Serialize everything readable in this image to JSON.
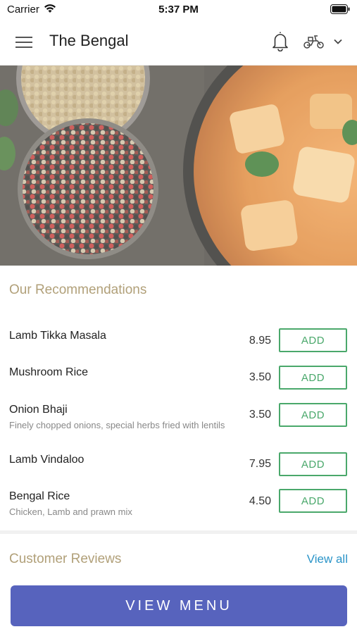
{
  "status_bar": {
    "carrier": "Carrier",
    "time": "5:37 PM"
  },
  "header": {
    "title": "The Bengal",
    "icons": [
      "menu-icon",
      "bell-icon",
      "scooter-icon",
      "chevron-down-icon"
    ]
  },
  "hero": {
    "image": "spices-and-curry-photo"
  },
  "recommendations": {
    "title": "Our Recommendations",
    "items": [
      {
        "name": "Lamb Tikka Masala",
        "description": "",
        "price": "8.95",
        "add_label": "ADD"
      },
      {
        "name": "Mushroom Rice",
        "description": "",
        "price": "3.50",
        "add_label": "ADD"
      },
      {
        "name": "Onion Bhaji",
        "description": "Finely chopped onions, special herbs fried with lentils",
        "price": "3.50",
        "add_label": "ADD"
      },
      {
        "name": "Lamb Vindaloo",
        "description": "",
        "price": "7.95",
        "add_label": "ADD"
      },
      {
        "name": "Bengal Rice",
        "description": "Chicken, Lamb and prawn mix",
        "price": "4.50",
        "add_label": "ADD"
      }
    ]
  },
  "reviews": {
    "title": "Customer Reviews",
    "view_all_label": "View all"
  },
  "footer": {
    "view_menu_label": "VIEW MENU"
  },
  "colors": {
    "accent_gold": "#b1a079",
    "add_green": "#4aa86b",
    "link_blue": "#2a94c8",
    "primary_button": "#5763bd"
  }
}
